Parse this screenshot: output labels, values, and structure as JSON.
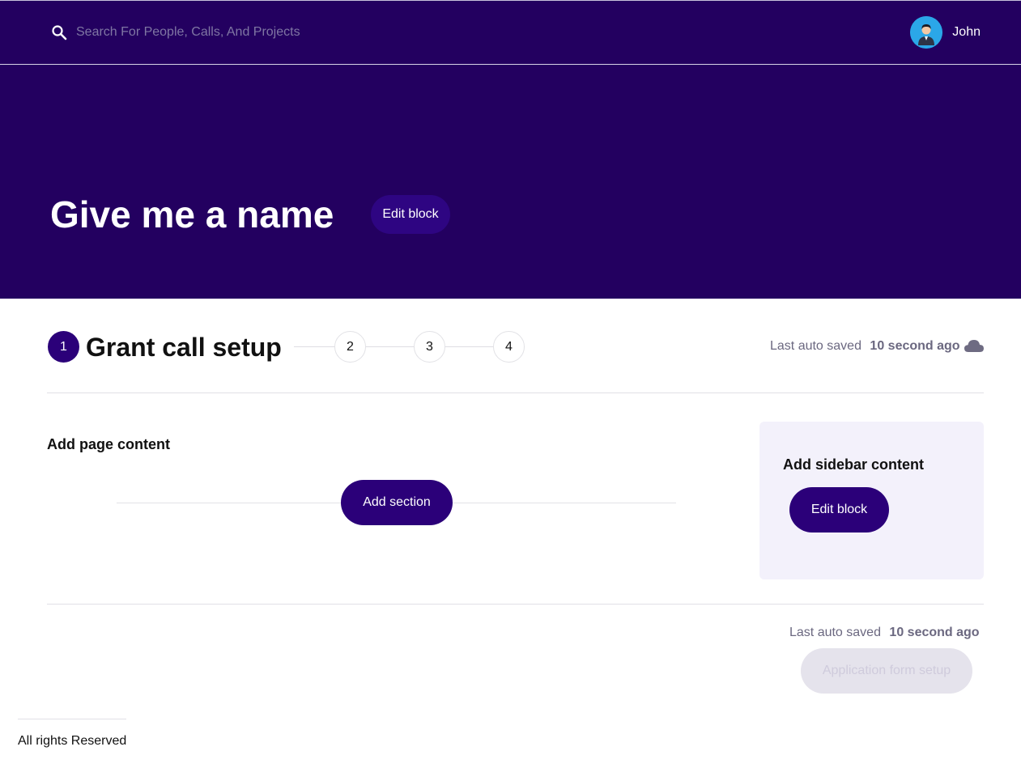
{
  "topbar": {
    "search_placeholder": "Search For People, Calls, And Projects",
    "search_icon": "search-icon",
    "user_name": "John",
    "avatar_icon": "user-avatar"
  },
  "hero": {
    "title": "Give me a name",
    "edit_label": "Edit block"
  },
  "stepper": {
    "current_step": "1",
    "current_title": "Grant call setup",
    "steps": [
      "2",
      "3",
      "4"
    ]
  },
  "autosave_top": {
    "label": "Last auto saved",
    "time": "10 second ago",
    "icon": "cloud-icon"
  },
  "page_content": {
    "title": "Add page content",
    "add_section_label": "Add section"
  },
  "sidebar": {
    "title": "Add sidebar content",
    "edit_label": "Edit block"
  },
  "autosave_bottom": {
    "label": "Last auto saved",
    "time": "10 second ago"
  },
  "next_button": {
    "label": "Application form setup",
    "state": "disabled"
  },
  "footer": {
    "text": "All rights Reserved"
  },
  "colors": {
    "brand": "#230060",
    "primary_button": "#2b0079",
    "sidebar_bg": "#f3f1fb",
    "disabled_button": "#e5e3ec"
  }
}
